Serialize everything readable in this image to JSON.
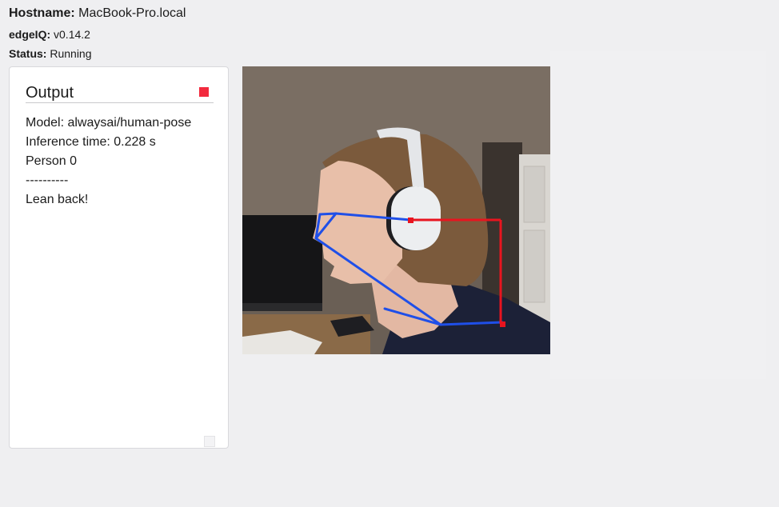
{
  "header": {
    "hostname_label": "Hostname:",
    "hostname_value": "MacBook-Pro.local",
    "edgeiq_label": "edgeIQ:",
    "edgeiq_value": "v0.14.2",
    "status_label": "Status:",
    "status_value": "Running"
  },
  "output_panel": {
    "title": "Output",
    "stop_icon": "stop-square-icon",
    "stop_color": "#f22a3e",
    "lines": [
      "Model: alwaysai/human-pose",
      "Inference time: 0.228 s",
      "Person 0",
      "----------",
      "Lean back!"
    ]
  },
  "video": {
    "skeleton_primary_color": "#1f4fe8",
    "skeleton_alert_color": "#e8141f"
  }
}
